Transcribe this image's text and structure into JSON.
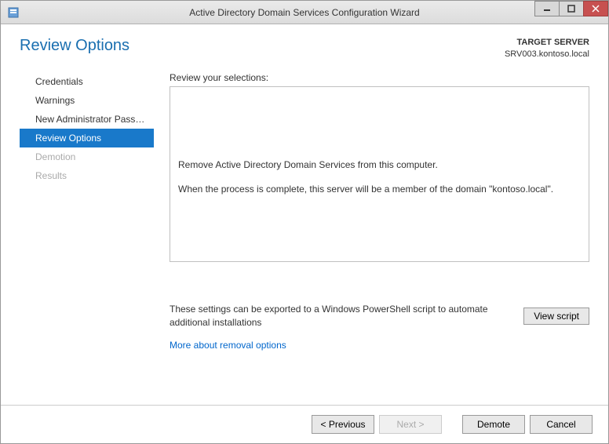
{
  "window": {
    "title": "Active Directory Domain Services Configuration Wizard"
  },
  "header": {
    "page_title": "Review Options",
    "target_label": "TARGET SERVER",
    "target_server": "SRV003.kontoso.local"
  },
  "sidebar": {
    "items": [
      {
        "label": "Credentials",
        "state": "normal"
      },
      {
        "label": "Warnings",
        "state": "normal"
      },
      {
        "label": "New Administrator Passw...",
        "state": "normal"
      },
      {
        "label": "Review Options",
        "state": "active"
      },
      {
        "label": "Demotion",
        "state": "disabled"
      },
      {
        "label": "Results",
        "state": "disabled"
      }
    ]
  },
  "main": {
    "selections_label": "Review your selections:",
    "selection_line1": "Remove Active Directory Domain Services from this computer.",
    "selection_line2": "When the process is complete, this server will be a member of the domain \"kontoso.local\".",
    "export_text": "These settings can be exported to a Windows PowerShell script to automate additional installations",
    "view_script": "View script",
    "more_link": "More about removal options"
  },
  "footer": {
    "previous": "< Previous",
    "next": "Next >",
    "demote": "Demote",
    "cancel": "Cancel"
  }
}
